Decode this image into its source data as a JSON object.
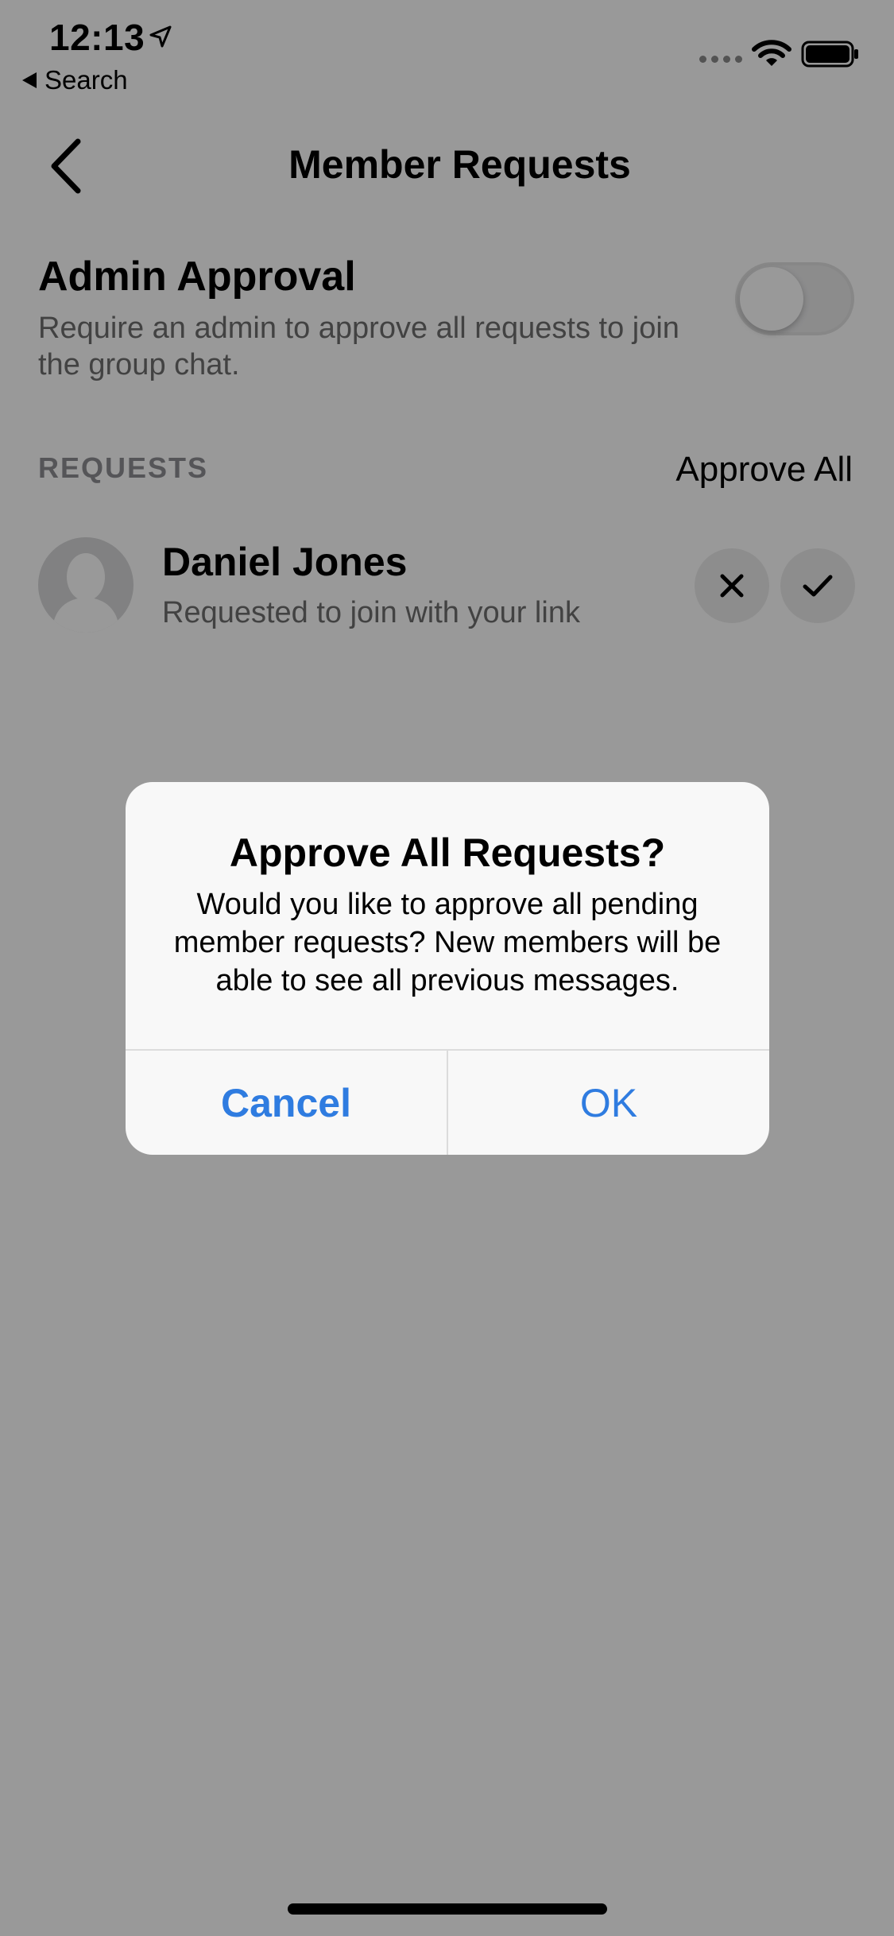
{
  "status_bar": {
    "time": "12:13",
    "back_app": "Search"
  },
  "nav": {
    "title": "Member Requests"
  },
  "admin_approval": {
    "title": "Admin Approval",
    "description": "Require an admin to approve all requests to join the group chat.",
    "enabled": false
  },
  "requests": {
    "header": "REQUESTS",
    "approve_all_label": "Approve All",
    "items": [
      {
        "name": "Daniel Jones",
        "subtitle": "Requested to join with your link"
      }
    ]
  },
  "alert": {
    "title": "Approve All Requests?",
    "message": "Would you like to approve all pending member requests? New members will be able to see all previous messages.",
    "cancel_label": "Cancel",
    "ok_label": "OK"
  },
  "colors": {
    "alert_button": "#2f7ce0",
    "overlay": "rgba(0,0,0,0.40)"
  }
}
